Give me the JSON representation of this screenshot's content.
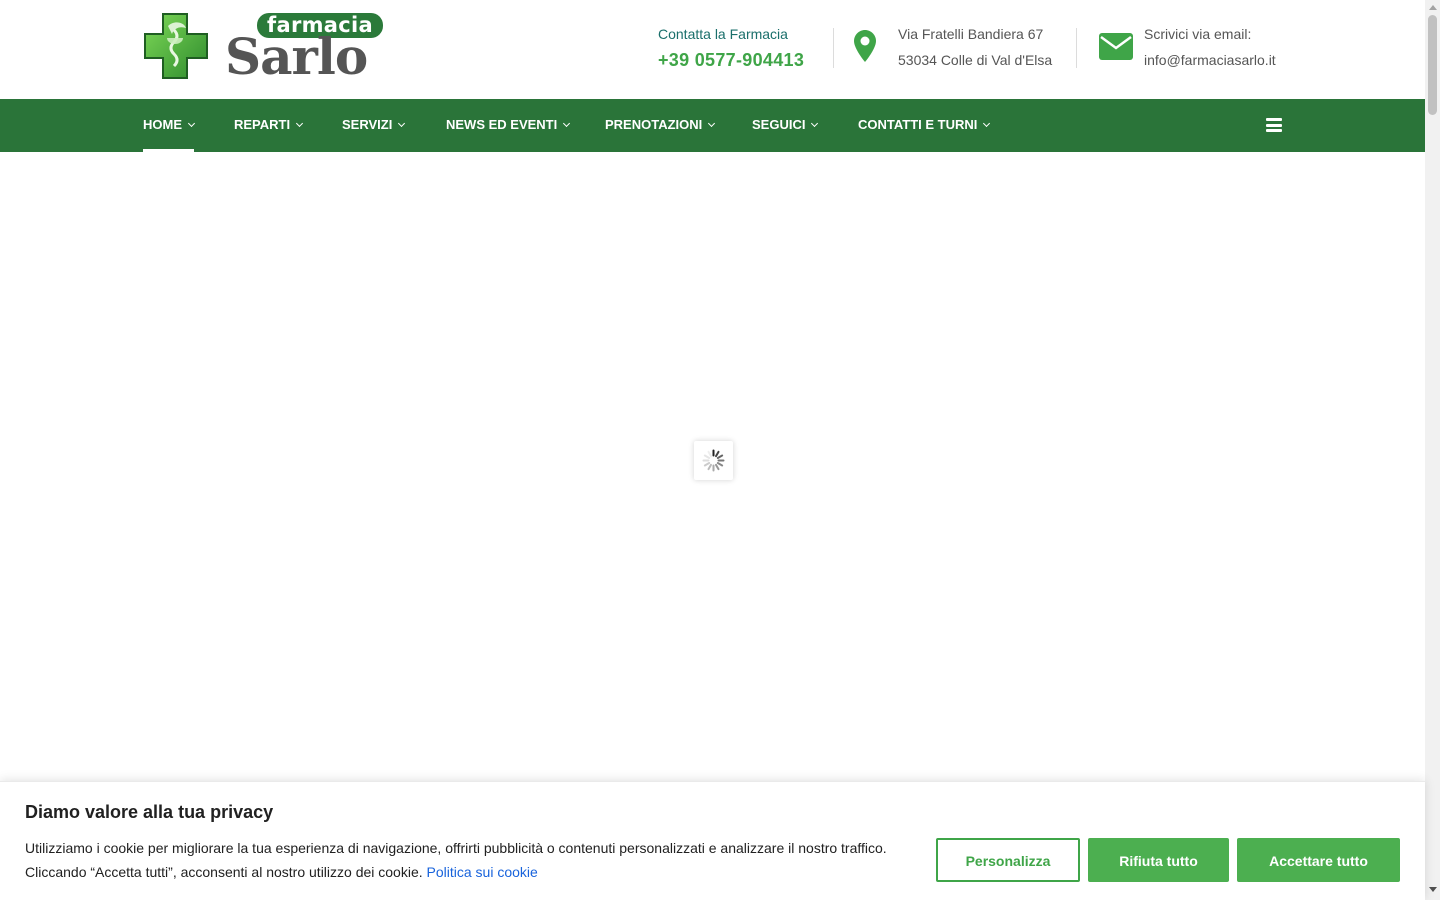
{
  "header": {
    "logo": {
      "badge_text": "farmacia",
      "word_text": "Sarlo"
    },
    "phone": {
      "label": "Contatta la Farmacia",
      "number": "+39 0577-904413"
    },
    "address": {
      "line1": "Via Fratelli Bandiera 67",
      "line2": "53034 Colle di Val d'Elsa"
    },
    "email": {
      "label": "Scrivici via email:",
      "address": "info@farmaciasarlo.it"
    }
  },
  "nav": {
    "items": [
      {
        "label": "HOME",
        "active": true
      },
      {
        "label": "REPARTI",
        "active": false
      },
      {
        "label": "SERVIZI",
        "active": false
      },
      {
        "label": "NEWS ED EVENTI",
        "active": false
      },
      {
        "label": "PRENOTAZIONI",
        "active": false
      },
      {
        "label": "SEGUICI",
        "active": false
      },
      {
        "label": "CONTATTI E TURNI",
        "active": false
      }
    ]
  },
  "cookie": {
    "title": "Diamo valore alla tua privacy",
    "text": "Utilizziamo i cookie per migliorare la tua esperienza di navigazione, offrirti pubblicità o contenuti personalizzati e analizzare il nostro traffico. Cliccando “Accetta tutti”, acconsenti al nostro utilizzo dei cookie.",
    "link": "Politica sui cookie",
    "buttons": {
      "customize": "Personalizza",
      "reject": "Rifiuta tutto",
      "accept": "Accettare tutto"
    }
  },
  "colors": {
    "brand_green": "#2a7439",
    "accent_green": "#3fa548",
    "button_green": "#4caf50",
    "link_blue": "#1863dc"
  },
  "icons": {
    "logo": "pharmacy-cross-logo",
    "address": "map-pin-icon",
    "email": "envelope-icon",
    "menu": "hamburger-icon",
    "loader": "spinner-icon"
  }
}
